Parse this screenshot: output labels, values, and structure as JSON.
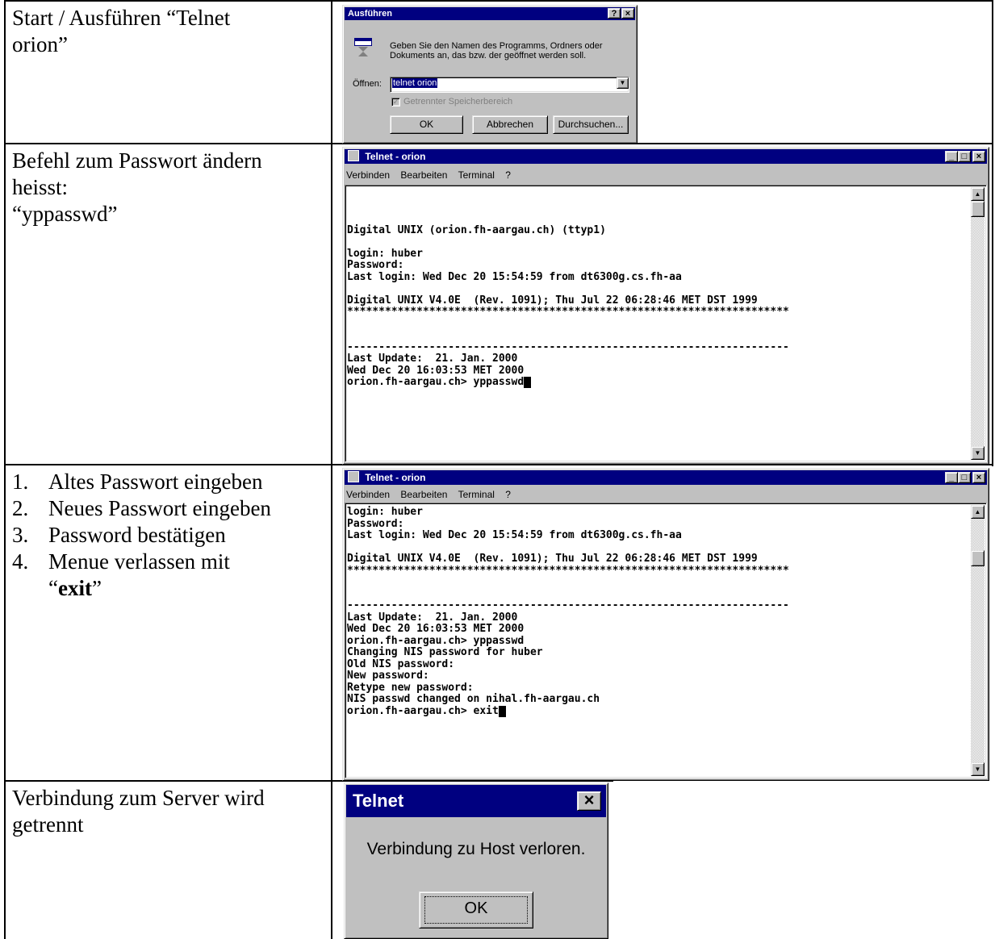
{
  "rows": [
    {
      "instruction": [
        "Start / Ausführen “Telnet",
        "orion”"
      ],
      "run_dialog": {
        "title": "Ausführen",
        "help_btn": "?",
        "close_btn": "×",
        "description_line1": "Geben Sie den Namen des Programms, Ordners oder",
        "description_line2": "Dokuments an, das bzw. der geöffnet werden soll.",
        "open_label": "Öffnen:",
        "open_value": "telnet orion",
        "checkbox_label": "Getrennter Speicherbereich",
        "ok_label": "OK",
        "cancel_label": "Abbrechen",
        "browse_label": "Durchsuchen..."
      }
    },
    {
      "instruction": [
        "Befehl zum Passwort ändern",
        "heisst:",
        "“yppasswd”"
      ],
      "telnet": {
        "title": "Telnet - orion",
        "menu": [
          "Verbinden",
          "Bearbeiten",
          "Terminal",
          "?"
        ],
        "terminal_lines": [
          "",
          "Digital UNIX (orion.fh-aargau.ch) (ttyp1)",
          "",
          "login: huber",
          "Password:",
          "Last login: Wed Dec 20 15:54:59 from dt6300g.cs.fh-aa",
          "",
          "Digital UNIX V4.0E  (Rev. 1091); Thu Jul 22 06:28:46 MET DST 1999",
          "**********************************************************************",
          "",
          "",
          "----------------------------------------------------------------------",
          "Last Update:  21. Jan. 2000",
          "Wed Dec 20 16:03:53 MET 2000"
        ],
        "prompt_line": "orion.fh-aargau.ch> yppasswd"
      }
    },
    {
      "instruction_steps": [
        {
          "num": "1.",
          "text": "Altes Passwort eingeben"
        },
        {
          "num": "2.",
          "text": "Neues Passwort eingeben"
        },
        {
          "num": "3.",
          "text": "Password bestätigen"
        },
        {
          "num": "4.",
          "text": "Menue verlassen mit"
        }
      ],
      "exit_open_quote": "“",
      "exit_word": "exit",
      "exit_close_quote": "”",
      "telnet": {
        "title": "Telnet - orion",
        "menu": [
          "Verbinden",
          "Bearbeiten",
          "Terminal",
          "?"
        ],
        "terminal_lines": [
          "login: huber",
          "Password:",
          "Last login: Wed Dec 20 15:54:59 from dt6300g.cs.fh-aa",
          "",
          "Digital UNIX V4.0E  (Rev. 1091); Thu Jul 22 06:28:46 MET DST 1999",
          "**********************************************************************",
          "",
          "",
          "----------------------------------------------------------------------",
          "Last Update:  21. Jan. 2000",
          "Wed Dec 20 16:03:53 MET 2000",
          "orion.fh-aargau.ch> yppasswd",
          "Changing NIS password for huber",
          "Old NIS password:",
          "New password:",
          "Retype new password:",
          "NIS passwd changed on nihal.fh-aargau.ch"
        ],
        "prompt_line": "orion.fh-aargau.ch> exit"
      }
    },
    {
      "instruction": [
        "Verbindung zum Server wird",
        "getrennt"
      ],
      "msgbox": {
        "title": "Telnet",
        "close_btn": "×",
        "message": "Verbindung zu Host verloren.",
        "ok_label": "OK"
      }
    }
  ]
}
